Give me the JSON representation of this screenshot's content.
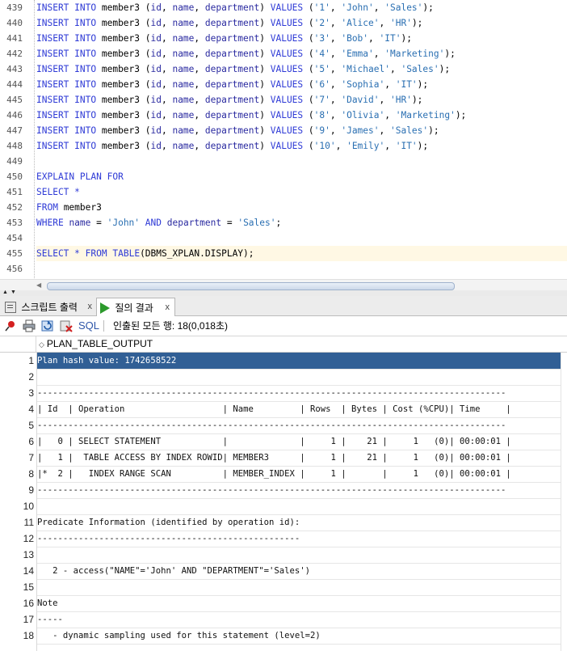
{
  "editor": {
    "lines": [
      {
        "num": "439",
        "code": "INSERT INTO member3 (id, name, department) VALUES ('1', 'John', 'Sales');"
      },
      {
        "num": "440",
        "code": "INSERT INTO member3 (id, name, department) VALUES ('2', 'Alice', 'HR');"
      },
      {
        "num": "441",
        "code": "INSERT INTO member3 (id, name, department) VALUES ('3', 'Bob', 'IT');"
      },
      {
        "num": "442",
        "code": "INSERT INTO member3 (id, name, department) VALUES ('4', 'Emma', 'Marketing');"
      },
      {
        "num": "443",
        "code": "INSERT INTO member3 (id, name, department) VALUES ('5', 'Michael', 'Sales');"
      },
      {
        "num": "444",
        "code": "INSERT INTO member3 (id, name, department) VALUES ('6', 'Sophia', 'IT');"
      },
      {
        "num": "445",
        "code": "INSERT INTO member3 (id, name, department) VALUES ('7', 'David', 'HR');"
      },
      {
        "num": "446",
        "code": "INSERT INTO member3 (id, name, department) VALUES ('8', 'Olivia', 'Marketing');"
      },
      {
        "num": "447",
        "code": "INSERT INTO member3 (id, name, department) VALUES ('9', 'James', 'Sales');"
      },
      {
        "num": "448",
        "code": "INSERT INTO member3 (id, name, department) VALUES ('10', 'Emily', 'IT');"
      },
      {
        "num": "449",
        "code": ""
      },
      {
        "num": "450",
        "code": "EXPLAIN PLAN FOR"
      },
      {
        "num": "451",
        "code": "SELECT *"
      },
      {
        "num": "452",
        "code": "FROM member3"
      },
      {
        "num": "453",
        "code": "WHERE name = 'John' AND department = 'Sales';"
      },
      {
        "num": "454",
        "code": ""
      },
      {
        "num": "455",
        "code": "SELECT * FROM TABLE(DBMS_XPLAN.DISPLAY);"
      },
      {
        "num": "456",
        "code": ""
      }
    ],
    "active_line": 16
  },
  "tabs": {
    "script_output": "스크립트 출력",
    "query_result": "질의 결과",
    "close": "x"
  },
  "toolbar": {
    "sql_label": "SQL",
    "separator": "|",
    "fetch_status": "인출된 모든 행: 18(0,018초)"
  },
  "grid": {
    "column_header": "PLAN_TABLE_OUTPUT",
    "rows": [
      {
        "num": "1",
        "text": "Plan hash value: 1742658522"
      },
      {
        "num": "2",
        "text": ""
      },
      {
        "num": "3",
        "text": "-------------------------------------------------------------------------------------------"
      },
      {
        "num": "4",
        "text": "| Id  | Operation                   | Name         | Rows  | Bytes | Cost (%CPU)| Time     |"
      },
      {
        "num": "5",
        "text": "-------------------------------------------------------------------------------------------"
      },
      {
        "num": "6",
        "text": "|   0 | SELECT STATEMENT            |              |     1 |    21 |     1   (0)| 00:00:01 |"
      },
      {
        "num": "7",
        "text": "|   1 |  TABLE ACCESS BY INDEX ROWID| MEMBER3      |     1 |    21 |     1   (0)| 00:00:01 |"
      },
      {
        "num": "8",
        "text": "|*  2 |   INDEX RANGE SCAN          | MEMBER_INDEX |     1 |       |     1   (0)| 00:00:01 |"
      },
      {
        "num": "9",
        "text": "-------------------------------------------------------------------------------------------"
      },
      {
        "num": "10",
        "text": ""
      },
      {
        "num": "11",
        "text": "Predicate Information (identified by operation id):"
      },
      {
        "num": "12",
        "text": "---------------------------------------------------"
      },
      {
        "num": "13",
        "text": ""
      },
      {
        "num": "14",
        "text": "   2 - access(\"NAME\"='John' AND \"DEPARTMENT\"='Sales')"
      },
      {
        "num": "15",
        "text": ""
      },
      {
        "num": "16",
        "text": "Note"
      },
      {
        "num": "17",
        "text": "-----"
      },
      {
        "num": "18",
        "text": "   - dynamic sampling used for this statement (level=2)"
      }
    ],
    "selected_row": 0
  },
  "colors": {
    "selection": "#315f95",
    "active_line": "#fff8e4",
    "keyword": "#2e3ad6",
    "string": "#2a6fb2"
  },
  "icons": {
    "pin": "pin-icon",
    "print": "print-icon",
    "refresh": "refresh-icon",
    "cancel": "cancel-icon",
    "run": "run-icon",
    "script": "script-icon",
    "sort": "sort-icon"
  }
}
